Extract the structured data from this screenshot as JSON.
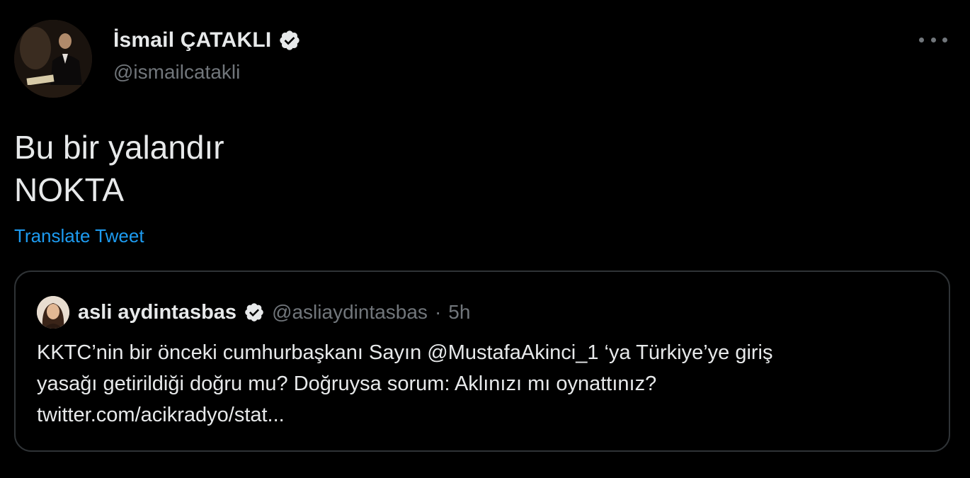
{
  "tweet": {
    "author": {
      "display_name": "İsmail ÇATAKLI",
      "handle": "@ismailcatakli",
      "avatar_icon": "profile-photo",
      "verified": true
    },
    "more_icon": "more-horizontal-icon",
    "text_lines": [
      "Bu bir yalandır",
      "NOKTA"
    ],
    "translate_label": "Translate Tweet"
  },
  "quote": {
    "author": {
      "display_name": "asli aydintasbas",
      "handle": "@asliaydintasbas",
      "separator": "·",
      "time": "5h",
      "verified": true
    },
    "text_lines": [
      "KKTC’nin bir önceki cumhurbaşkanı Sayın @MustafaAkinci_1 ‘ya Türkiye’ye giriş",
      "yasağı getirildiği doğru mu? Doğruysa sorum: Aklınızı mı oynattınız?",
      "twitter.com/acikradyo/stat..."
    ]
  },
  "colors": {
    "background": "#000000",
    "primary_text": "#e7e9ea",
    "secondary_text": "#71767b",
    "link": "#1d9bf0",
    "border": "#2f3336"
  }
}
